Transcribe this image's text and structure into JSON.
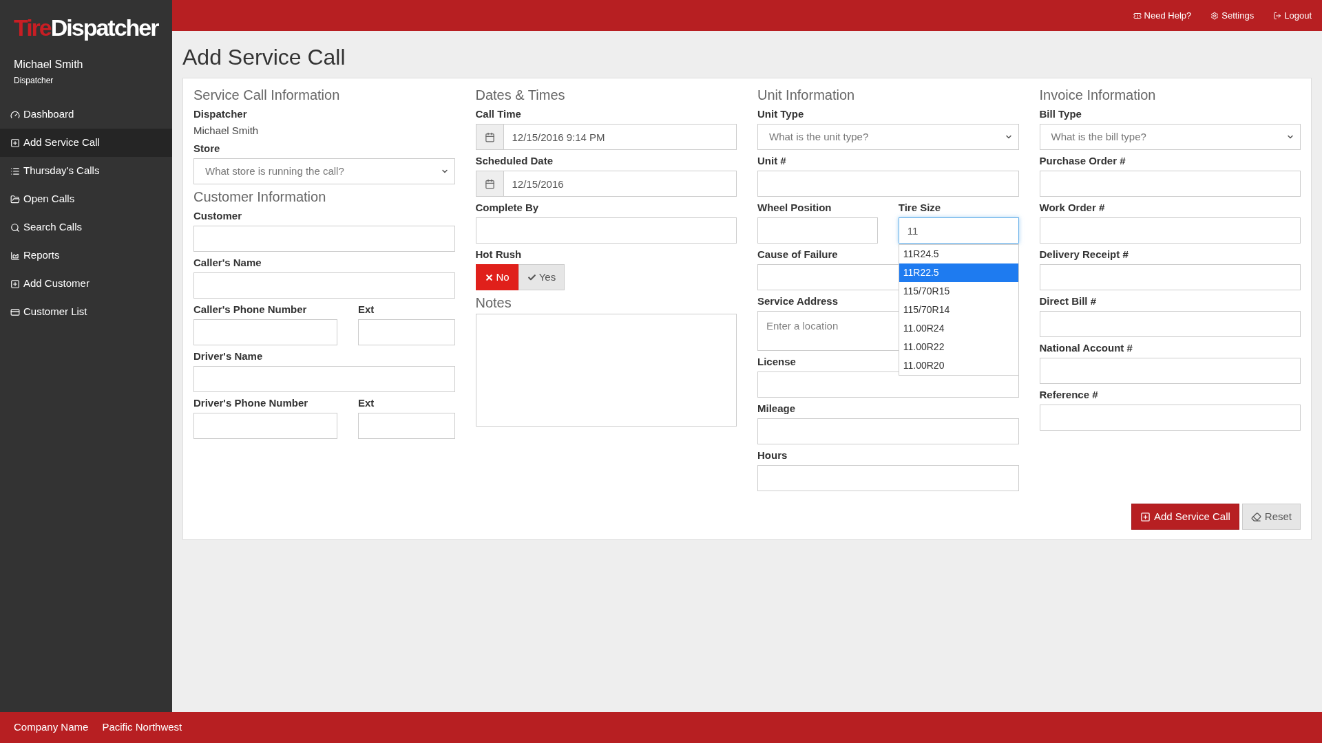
{
  "topbar": {
    "links": [
      {
        "label": "Need Help?"
      },
      {
        "label": "Settings"
      },
      {
        "label": "Logout"
      }
    ]
  },
  "sidebar": {
    "logo": {
      "accent": "Tire",
      "rest": "Dispatcher"
    },
    "user": {
      "name": "Michael Smith",
      "role": "Dispatcher"
    },
    "items": [
      {
        "label": "Dashboard",
        "selected": false
      },
      {
        "label": "Add Service Call",
        "selected": true
      },
      {
        "label": "Thursday's Calls",
        "selected": false
      },
      {
        "label": "Open Calls",
        "selected": false
      },
      {
        "label": "Search Calls",
        "selected": false
      },
      {
        "label": "Reports",
        "selected": false
      },
      {
        "label": "Add Customer",
        "selected": false
      },
      {
        "label": "Customer List",
        "selected": false
      }
    ]
  },
  "page_title": "Add Service Call",
  "columns": [
    {
      "blocks": [
        {
          "kind": "heading",
          "text": "Service Call Information"
        },
        {
          "kind": "static",
          "label": "Dispatcher",
          "value": "Michael Smith"
        },
        {
          "kind": "select",
          "label": "Store",
          "placeholder": "What store is running the call?"
        },
        {
          "kind": "heading",
          "text": "Customer Information"
        },
        {
          "kind": "input",
          "label": "Customer"
        },
        {
          "kind": "input",
          "label": "Caller's Name"
        },
        {
          "kind": "input_ext",
          "fields": [
            {
              "label": "Caller's Phone Number"
            },
            {
              "label": "Ext"
            }
          ]
        },
        {
          "kind": "input",
          "label": "Driver's Name"
        },
        {
          "kind": "input_ext",
          "fields": [
            {
              "label": "Driver's Phone Number"
            },
            {
              "label": "Ext"
            }
          ]
        }
      ]
    },
    {
      "blocks": [
        {
          "kind": "heading",
          "text": "Dates & Times"
        },
        {
          "kind": "date",
          "label": "Call Time",
          "value": "12/15/2016 9:14 PM"
        },
        {
          "kind": "date",
          "label": "Scheduled Date",
          "value": "12/15/2016"
        },
        {
          "kind": "input",
          "label": "Complete By"
        },
        {
          "kind": "toggle",
          "label": "Hot Rush",
          "options": [
            {
              "label": "No",
              "selected": true
            },
            {
              "label": "Yes",
              "selected": false
            }
          ]
        },
        {
          "kind": "heading",
          "text": "Notes"
        },
        {
          "kind": "textarea"
        }
      ]
    },
    {
      "blocks": [
        {
          "kind": "heading",
          "text": "Unit Information"
        },
        {
          "kind": "select",
          "label": "Unit Type",
          "placeholder": "What is the unit type?"
        },
        {
          "kind": "input",
          "label": "Unit #"
        },
        {
          "kind": "input_half",
          "fields": [
            {
              "label": "Wheel Position"
            },
            {
              "label": "Tire Size",
              "value": "11",
              "focused": true,
              "suggestions": [
                {
                  "label": "11R24.5",
                  "selected": false
                },
                {
                  "label": "11R22.5",
                  "selected": true
                },
                {
                  "label": "115/70R15",
                  "selected": false
                },
                {
                  "label": "115/70R14",
                  "selected": false
                },
                {
                  "label": "11.00R24",
                  "selected": false
                },
                {
                  "label": "11.00R22",
                  "selected": false
                },
                {
                  "label": "11.00R20",
                  "selected": false
                }
              ]
            }
          ]
        },
        {
          "kind": "input",
          "label": "Cause of Failure"
        },
        {
          "kind": "location",
          "label": "Service Address",
          "placeholder": "Enter a location"
        },
        {
          "kind": "input",
          "label": "License"
        },
        {
          "kind": "input",
          "label": "Mileage"
        },
        {
          "kind": "input",
          "label": "Hours"
        }
      ]
    },
    {
      "blocks": [
        {
          "kind": "heading",
          "text": "Invoice Information"
        },
        {
          "kind": "select",
          "label": "Bill Type",
          "placeholder": "What is the bill type?"
        },
        {
          "kind": "input",
          "label": "Purchase Order #"
        },
        {
          "kind": "input",
          "label": "Work Order #"
        },
        {
          "kind": "input",
          "label": "Delivery Receipt #"
        },
        {
          "kind": "input",
          "label": "Direct Bill #"
        },
        {
          "kind": "input",
          "label": "National Account #"
        },
        {
          "kind": "input",
          "label": "Reference #"
        }
      ]
    }
  ],
  "actions": [
    {
      "label": "Add Service Call",
      "kind": "primary"
    },
    {
      "label": "Reset",
      "kind": "default"
    }
  ],
  "footer": {
    "items": [
      "Company Name",
      "Pacific Northwest"
    ]
  }
}
